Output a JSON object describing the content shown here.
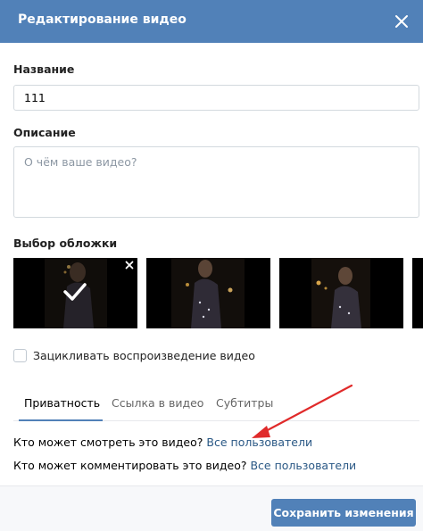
{
  "header": {
    "title": "Редактирование видео"
  },
  "fields": {
    "name_label": "Название",
    "name_value": "111",
    "description_label": "Описание",
    "description_placeholder": "О чём ваше видео?",
    "cover_label": "Выбор обложки"
  },
  "loop": {
    "label": "Зацикливать воспроизведение видео",
    "checked": false
  },
  "tabs": [
    {
      "label": "Приватность",
      "active": true
    },
    {
      "label": "Ссылка в видео",
      "active": false
    },
    {
      "label": "Субтитры",
      "active": false
    }
  ],
  "privacy": {
    "view_question": "Кто может смотреть это видео?",
    "view_value": "Все пользователи",
    "comment_question": "Кто может комментировать это видео?",
    "comment_value": "Все пользователи"
  },
  "footer": {
    "save_label": "Сохранить изменения"
  },
  "colors": {
    "header": "#5181b8",
    "link": "#2a5885",
    "annotation_arrow": "#e02a2a"
  }
}
